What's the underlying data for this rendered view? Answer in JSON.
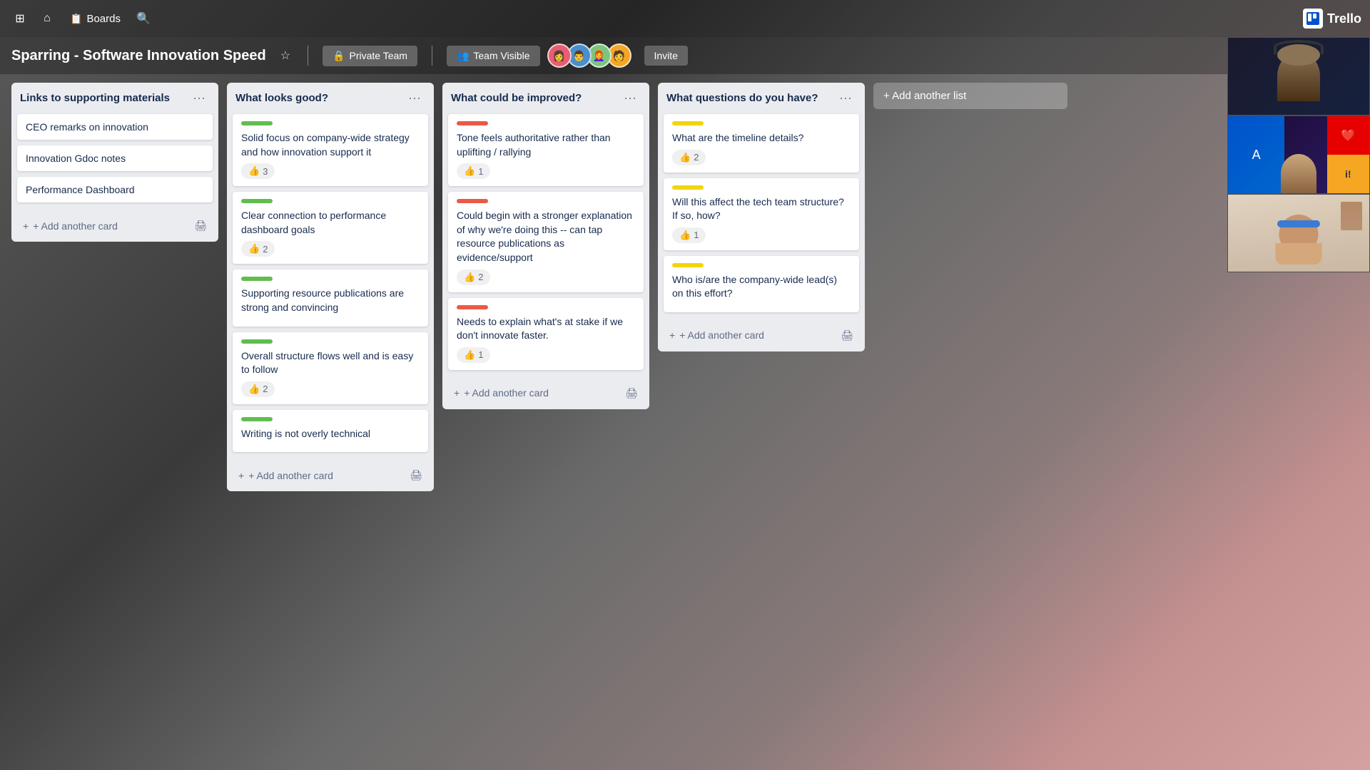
{
  "topbar": {
    "grid_icon": "⊞",
    "home_icon": "⌂",
    "boards_label": "Boards",
    "search_icon": "🔍"
  },
  "trello": {
    "logo_text": "Trello",
    "logo_icon": "📋"
  },
  "board": {
    "title": "Sparring - Software Innovation Speed",
    "star_icon": "☆",
    "visibility_private": "Private Team",
    "visibility_team": "Team Visible",
    "invite_label": "Invite"
  },
  "lists": [
    {
      "id": "list-1",
      "title": "Links to supporting materials",
      "cards": [
        {
          "id": "c1",
          "text": "CEO remarks on innovation",
          "label": null,
          "likes": null
        },
        {
          "id": "c2",
          "text": "Innovation Gdoc notes",
          "label": null,
          "likes": null
        },
        {
          "id": "c3",
          "text": "Performance Dashboard",
          "label": null,
          "likes": null
        }
      ]
    },
    {
      "id": "list-2",
      "title": "What looks good?",
      "cards": [
        {
          "id": "c4",
          "text": "Solid focus on company-wide strategy and how innovation support it",
          "label": "green",
          "likes": 3
        },
        {
          "id": "c5",
          "text": "Clear connection to performance dashboard goals",
          "label": "green",
          "likes": 2
        },
        {
          "id": "c6",
          "text": "Supporting resource publications are strong and convincing",
          "label": "green",
          "likes": null
        },
        {
          "id": "c7",
          "text": "Overall structure flows well and is easy to follow",
          "label": "green",
          "likes": 2
        },
        {
          "id": "c8",
          "text": "Writing is not overly technical",
          "label": "green",
          "likes": null
        }
      ]
    },
    {
      "id": "list-3",
      "title": "What could be improved?",
      "cards": [
        {
          "id": "c9",
          "text": "Tone feels authoritative rather than uplifting / rallying",
          "label": "red",
          "likes": 1
        },
        {
          "id": "c10",
          "text": "Could begin with a stronger explanation of why we're doing this -- can tap resource publications as evidence/support",
          "label": "red",
          "likes": 2
        },
        {
          "id": "c11",
          "text": "Needs to explain what's at stake if we don't innovate faster.",
          "label": "red",
          "likes": 1
        }
      ]
    },
    {
      "id": "list-4",
      "title": "What questions do you have?",
      "cards": [
        {
          "id": "c12",
          "text": "What are the timeline details?",
          "label": "yellow",
          "likes": 2
        },
        {
          "id": "c13",
          "text": "Will this affect the tech team structure? If so, how?",
          "label": "yellow",
          "likes": 1
        },
        {
          "id": "c14",
          "text": "Who is/are the company-wide lead(s) on this effort?",
          "label": "yellow",
          "likes": null
        }
      ]
    }
  ],
  "add_card_label": "+ Add another card",
  "add_list_label": "+ Add another list",
  "menu_icon": "···",
  "like_icon": "👍",
  "print_icon": "🖨",
  "avatars": [
    "#e85d75",
    "#4a8fcb",
    "#7bc67e",
    "#f5a623"
  ],
  "avatar_emojis": [
    "👩",
    "👨",
    "👩‍🦰",
    "🧑"
  ]
}
